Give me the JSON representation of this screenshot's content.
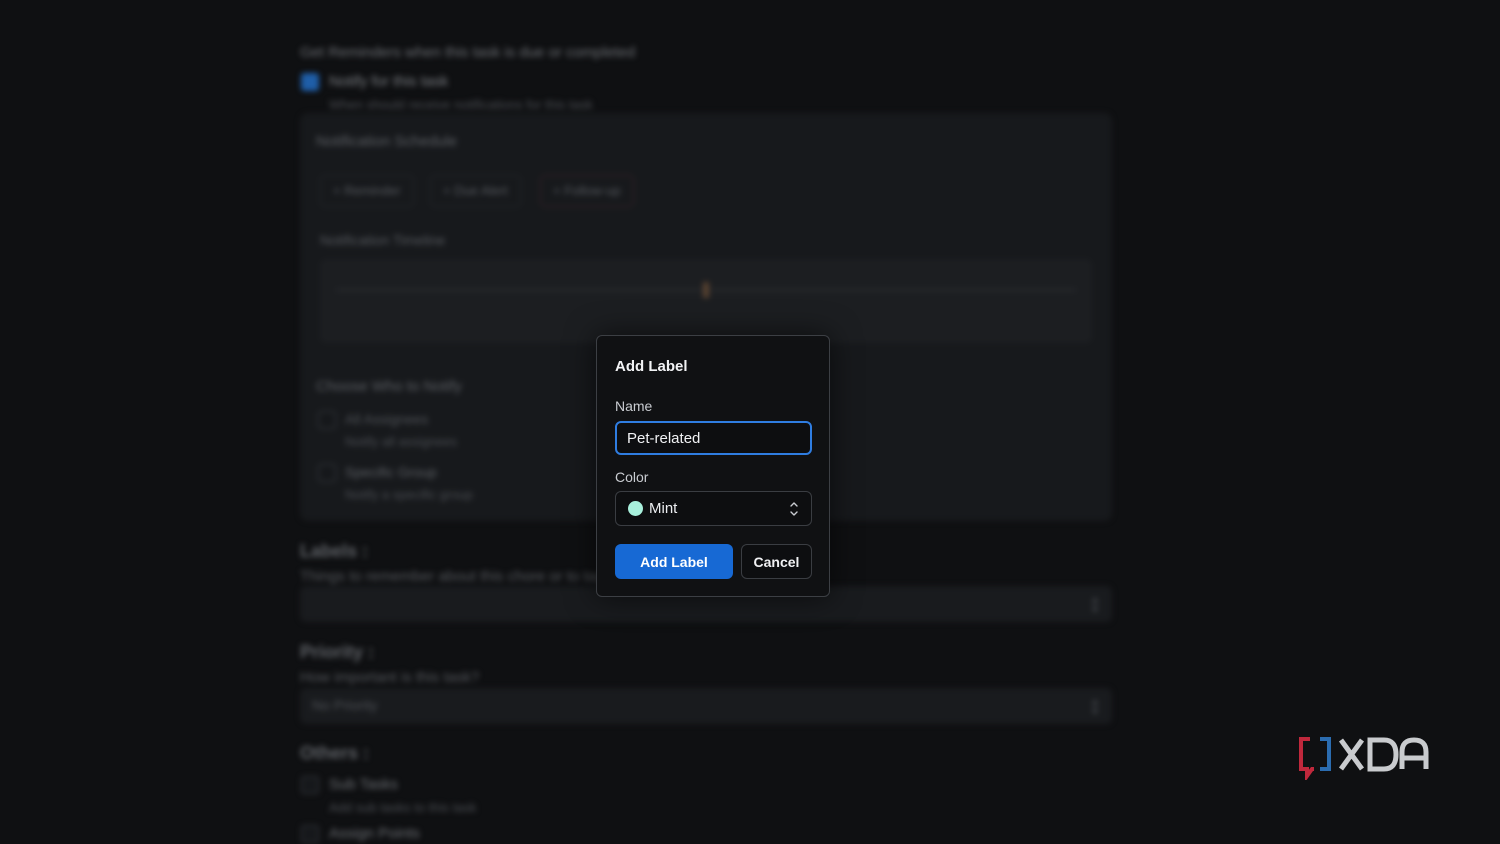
{
  "background": {
    "reminder_heading": "Get Reminders when this task is due or completed",
    "notify_label": "Notify for this task",
    "notify_sub": "When should receive notifications for this task",
    "schedule_title": "Notification Schedule",
    "chips": [
      "Reminder",
      "Due Alert",
      "Follow-up"
    ],
    "timeline_title": "Notification Timeline",
    "choose_title": "Choose Who to Notify",
    "all_assignees": "All Assignees",
    "all_assignees_sub": "Notify all assignees",
    "specific_group": "Specific Group",
    "specific_group_sub": "Notify a specific group",
    "labels_heading": "Labels :",
    "labels_sub": "Things to remember about this chore or to tag it",
    "priority_heading": "Priority :",
    "priority_sub": "How important is this task?",
    "priority_value": "No Priority",
    "others_heading": "Others :",
    "sub_tasks": "Sub Tasks",
    "sub_tasks_sub": "Add sub tasks to this task",
    "assign_points": "Assign Points"
  },
  "dialog": {
    "title": "Add Label",
    "name_label": "Name",
    "name_value": "Pet-related",
    "color_label": "Color",
    "color_value": "Mint",
    "color_swatch": "#a8f0dc",
    "add_button": "Add Label",
    "cancel_button": "Cancel"
  },
  "watermark": {
    "text": "XDA"
  },
  "colors": {
    "accent": "#1769d4",
    "focus_border": "#2f7de1",
    "background": "#0f1012"
  }
}
